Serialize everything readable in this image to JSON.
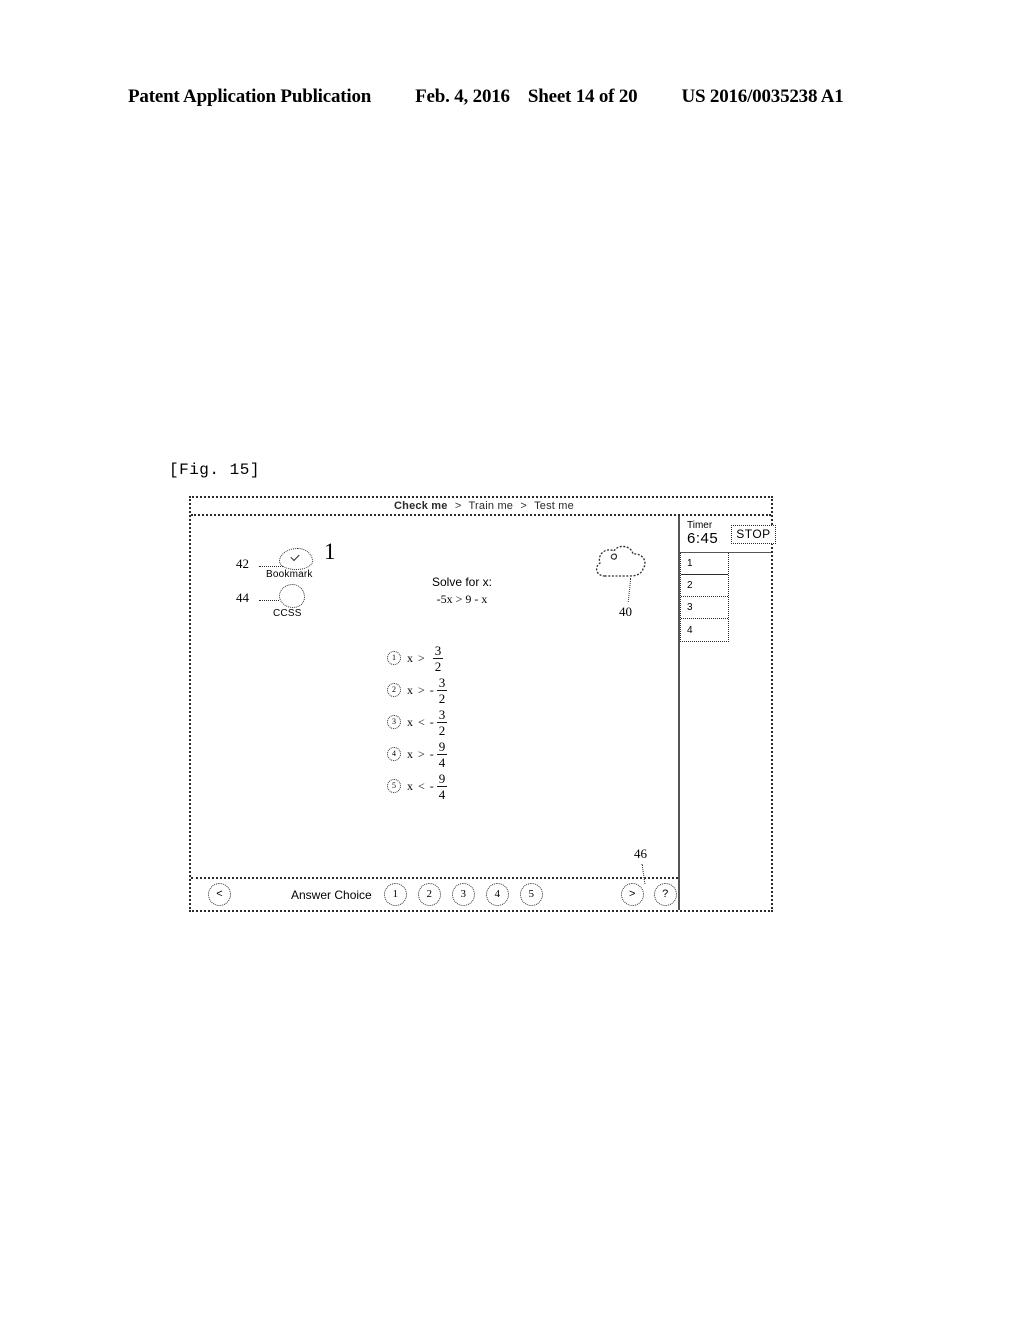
{
  "page_header": {
    "publication": "Patent Application Publication",
    "date": "Feb. 4, 2016",
    "sheet": "Sheet 14 of 20",
    "pub_number": "US 2016/0035238 A1"
  },
  "figure": {
    "label": "[Fig. 15]"
  },
  "breadcrumb": {
    "item1": "Check me",
    "sep1": ">",
    "item2": "Train me",
    "sep2": ">",
    "item3": "Test me"
  },
  "content": {
    "question_number": "1",
    "bookmark_caption": "Bookmark",
    "ccss_caption": "CCSS",
    "stem_prompt": "Solve for x:",
    "stem_equation": "-5x > 9 - x",
    "options": [
      {
        "marker": "1",
        "variable": "x",
        "relation": ">",
        "sign": "",
        "numerator": "3",
        "denominator": "2"
      },
      {
        "marker": "2",
        "variable": "x",
        "relation": ">",
        "sign": "-",
        "numerator": "3",
        "denominator": "2"
      },
      {
        "marker": "3",
        "variable": "x",
        "relation": "<",
        "sign": "-",
        "numerator": "3",
        "denominator": "2"
      },
      {
        "marker": "4",
        "variable": "x",
        "relation": ">",
        "sign": "-",
        "numerator": "9",
        "denominator": "4"
      },
      {
        "marker": "5",
        "variable": "x",
        "relation": "<",
        "sign": "-",
        "numerator": "9",
        "denominator": "4"
      }
    ]
  },
  "reference_numerals": {
    "bookmark": "42",
    "ccss": "44",
    "cloud": "40",
    "bottom_bar": "46"
  },
  "toolbar": {
    "prev_label": "<",
    "answer_choice_label": "Answer Choice",
    "choices": [
      "1",
      "2",
      "3",
      "4",
      "5"
    ],
    "next_label": ">",
    "help_label": "?"
  },
  "rail": {
    "timer_label": "Timer",
    "timer_value": "6:45",
    "stop_label": "STOP",
    "question_items": [
      "1",
      "2",
      "3",
      "4"
    ]
  },
  "icons": {
    "bookmark": "bookmark-check-icon",
    "ccss": "ccss-badge-icon",
    "cloud": "cloud-icon"
  },
  "colors": {
    "ink": "#1a1a1a",
    "frame": "#2b2b2b",
    "divider": "#555555",
    "paper": "#ffffff"
  }
}
